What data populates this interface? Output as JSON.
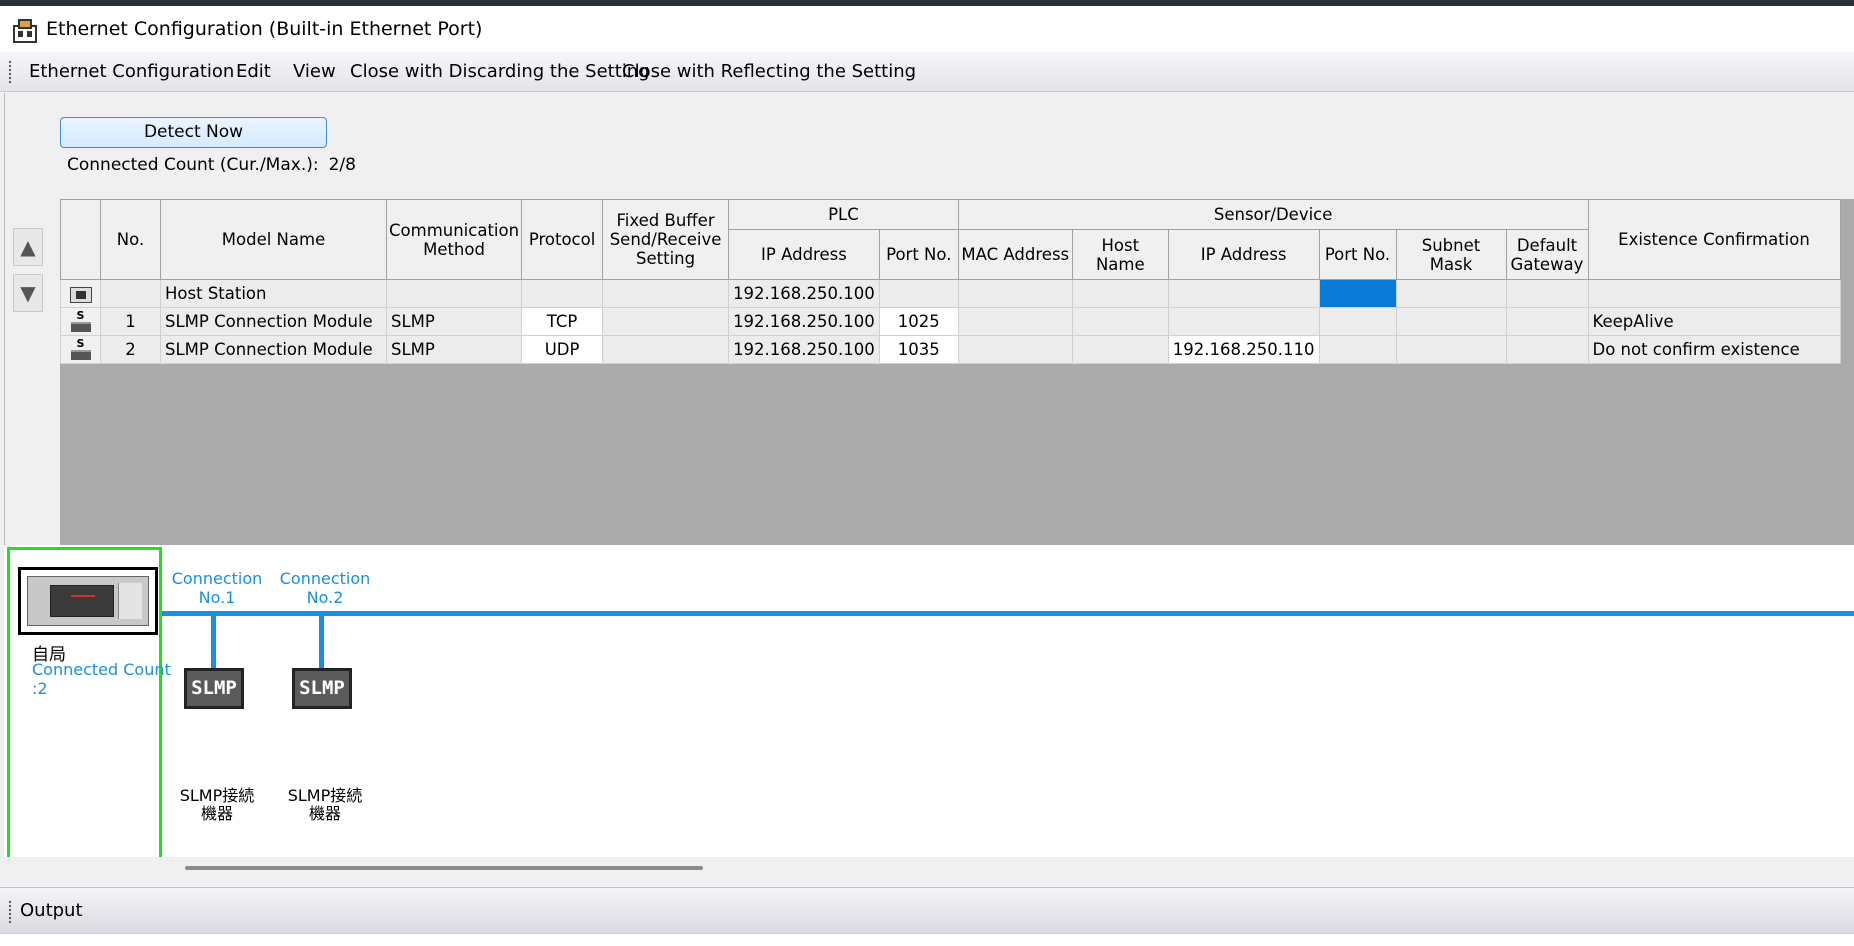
{
  "window": {
    "title": "Ethernet Configuration (Built-in Ethernet Port)"
  },
  "menu": [
    "Ethernet Configuration",
    "Edit",
    "View",
    "Close with Discarding the Setting",
    "Close with Reflecting the Setting"
  ],
  "toolbar": {
    "detect_label": "Detect Now",
    "connected_count_label": "Connected Count (Cur./Max.):",
    "connected_count_value": "2/8"
  },
  "table": {
    "headers": {
      "no": "No.",
      "model_name": "Model Name",
      "communication_method": "Communication Method",
      "protocol": "Protocol",
      "fixed_buffer": "Fixed Buffer Send/Receive Setting",
      "plc_group": "PLC",
      "plc_ip": "IP Address",
      "plc_port": "Port No.",
      "sensor_group": "Sensor/Device",
      "mac": "MAC Address",
      "host_name": "Host Name",
      "sensor_ip": "IP Address",
      "sensor_port": "Port No.",
      "subnet": "Subnet Mask",
      "gateway": "Default Gateway",
      "existence": "Existence Confirmation"
    },
    "rows": [
      {
        "icon": "host-station-icon",
        "no": "",
        "model": "Host Station",
        "method": "",
        "protocol": "",
        "fixed": "",
        "plc_ip": "192.168.250.100",
        "plc_port": "",
        "mac": "",
        "host": "",
        "sensor_ip": "",
        "sensor_port": "",
        "subnet": "",
        "gateway": "",
        "existence": ""
      },
      {
        "icon": "slmp-module-icon",
        "no": "1",
        "model": "SLMP Connection Module",
        "method": "SLMP",
        "protocol": "TCP",
        "fixed": "",
        "plc_ip": "192.168.250.100",
        "plc_port": "1025",
        "mac": "",
        "host": "",
        "sensor_ip": "",
        "sensor_port": "",
        "subnet": "",
        "gateway": "",
        "existence": "KeepAlive"
      },
      {
        "icon": "slmp-module-icon",
        "no": "2",
        "model": "SLMP Connection Module",
        "method": "SLMP",
        "protocol": "UDP",
        "fixed": "",
        "plc_ip": "192.168.250.100",
        "plc_port": "1035",
        "mac": "",
        "host": "",
        "sensor_ip": "192.168.250.110",
        "sensor_port": "",
        "subnet": "",
        "gateway": "",
        "existence": "Do not confirm existence"
      }
    ]
  },
  "diagram": {
    "host_label": "自局",
    "host_count_line1": "Connected Count",
    "host_count_line2": ":2",
    "connections": [
      {
        "label_line1": "Connection",
        "label_line2": "No.1",
        "node_text": "SLMP",
        "node_label_line1": "SLMP接続",
        "node_label_line2": "機器"
      },
      {
        "label_line1": "Connection",
        "label_line2": "No.2",
        "node_text": "SLMP",
        "node_label_line1": "SLMP接続",
        "node_label_line2": "機器"
      }
    ]
  },
  "output": {
    "title": "Output"
  },
  "colors": {
    "accent_blue": "#1a8fe0",
    "selection_blue": "#0a7ad6",
    "host_frame_green": "#21e021",
    "grid_background": "#ababab"
  }
}
